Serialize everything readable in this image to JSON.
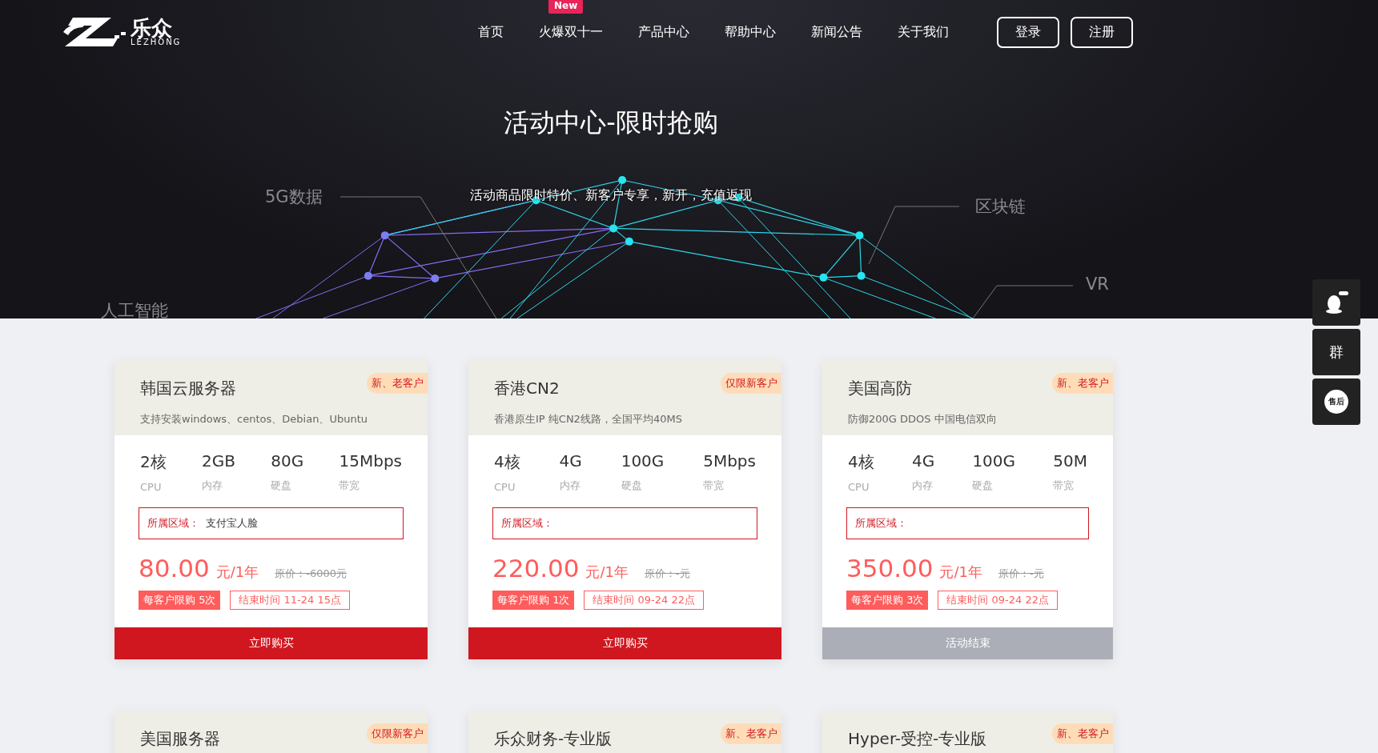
{
  "logo": {
    "name": "乐众",
    "subtitle": "LEZHONG"
  },
  "nav": [
    {
      "label": "首页"
    },
    {
      "label": "火爆双十一",
      "badge": "New"
    },
    {
      "label": "产品中心"
    },
    {
      "label": "帮助中心"
    },
    {
      "label": "新闻公告"
    },
    {
      "label": "关于我们"
    }
  ],
  "auth_buttons": [
    "登录",
    "注册"
  ],
  "hero": {
    "title": "活动中心-限时抢购",
    "subtitle": "活动商品限时特价、新客户专享，新开，充值返现",
    "tags": [
      "5G数据",
      "区块链",
      "VR",
      "人工智能"
    ]
  },
  "cards": [
    {
      "title": "韩国云服务器",
      "badge": "新、老客户",
      "description": "支持安装windows、centos、Debian、Ubuntu",
      "specs": [
        {
          "value": "2核",
          "label": "CPU"
        },
        {
          "value": "2GB",
          "label": "内存"
        },
        {
          "value": "80G",
          "label": "硬盘"
        },
        {
          "value": "15Mbps",
          "label": "带宽"
        }
      ],
      "region_label": "所属区域：",
      "region_value": "支付宝人脸",
      "price": "80.00",
      "unit": "元/1年",
      "original_price": "原价：-6000元",
      "limit": "每客户限购 5次",
      "end_time": "结束时间 11-24 15点",
      "button": {
        "label": "立即购买",
        "kind": "buy"
      }
    },
    {
      "title": "香港CN2",
      "badge": "仅限新客户",
      "description": "香港原生IP 纯CN2线路，全国平均40MS",
      "specs": [
        {
          "value": "4核",
          "label": "CPU"
        },
        {
          "value": "4G",
          "label": "内存"
        },
        {
          "value": "100G",
          "label": "硬盘"
        },
        {
          "value": "5Mbps",
          "label": "带宽"
        }
      ],
      "region_label": "所属区域：",
      "price": "220.00",
      "unit": "元/1年",
      "original_price": "原价：-元",
      "limit": "每客户限购 1次",
      "end_time": "结束时间 09-24 22点",
      "button": {
        "label": "立即购买",
        "kind": "buy"
      }
    },
    {
      "title": "美国高防",
      "badge": "新、老客户",
      "description": "防御200G DDOS 中国电信双向",
      "specs": [
        {
          "value": "4核",
          "label": "CPU"
        },
        {
          "value": "4G",
          "label": "内存"
        },
        {
          "value": "100G",
          "label": "硬盘"
        },
        {
          "value": "50M",
          "label": "带宽"
        }
      ],
      "region_label": "所属区域：",
      "price": "350.00",
      "unit": "元/1年",
      "original_price": "原价：-元",
      "limit": "每客户限购 3次",
      "end_time": "结束时间 09-24 22点",
      "button": {
        "label": "活动结束",
        "kind": "ended"
      }
    }
  ],
  "more_cards": [
    {
      "title": "美国服务器",
      "badge": "仅限新客户"
    },
    {
      "title": "乐众财务-专业版",
      "badge": "新、老客户"
    },
    {
      "title": "Hyper-受控-专业版",
      "badge": "新、老客户"
    }
  ],
  "side_buttons": [
    {
      "kind": "qq"
    },
    {
      "kind": "text",
      "label": "群"
    },
    {
      "kind": "circle",
      "label": "售后"
    }
  ]
}
